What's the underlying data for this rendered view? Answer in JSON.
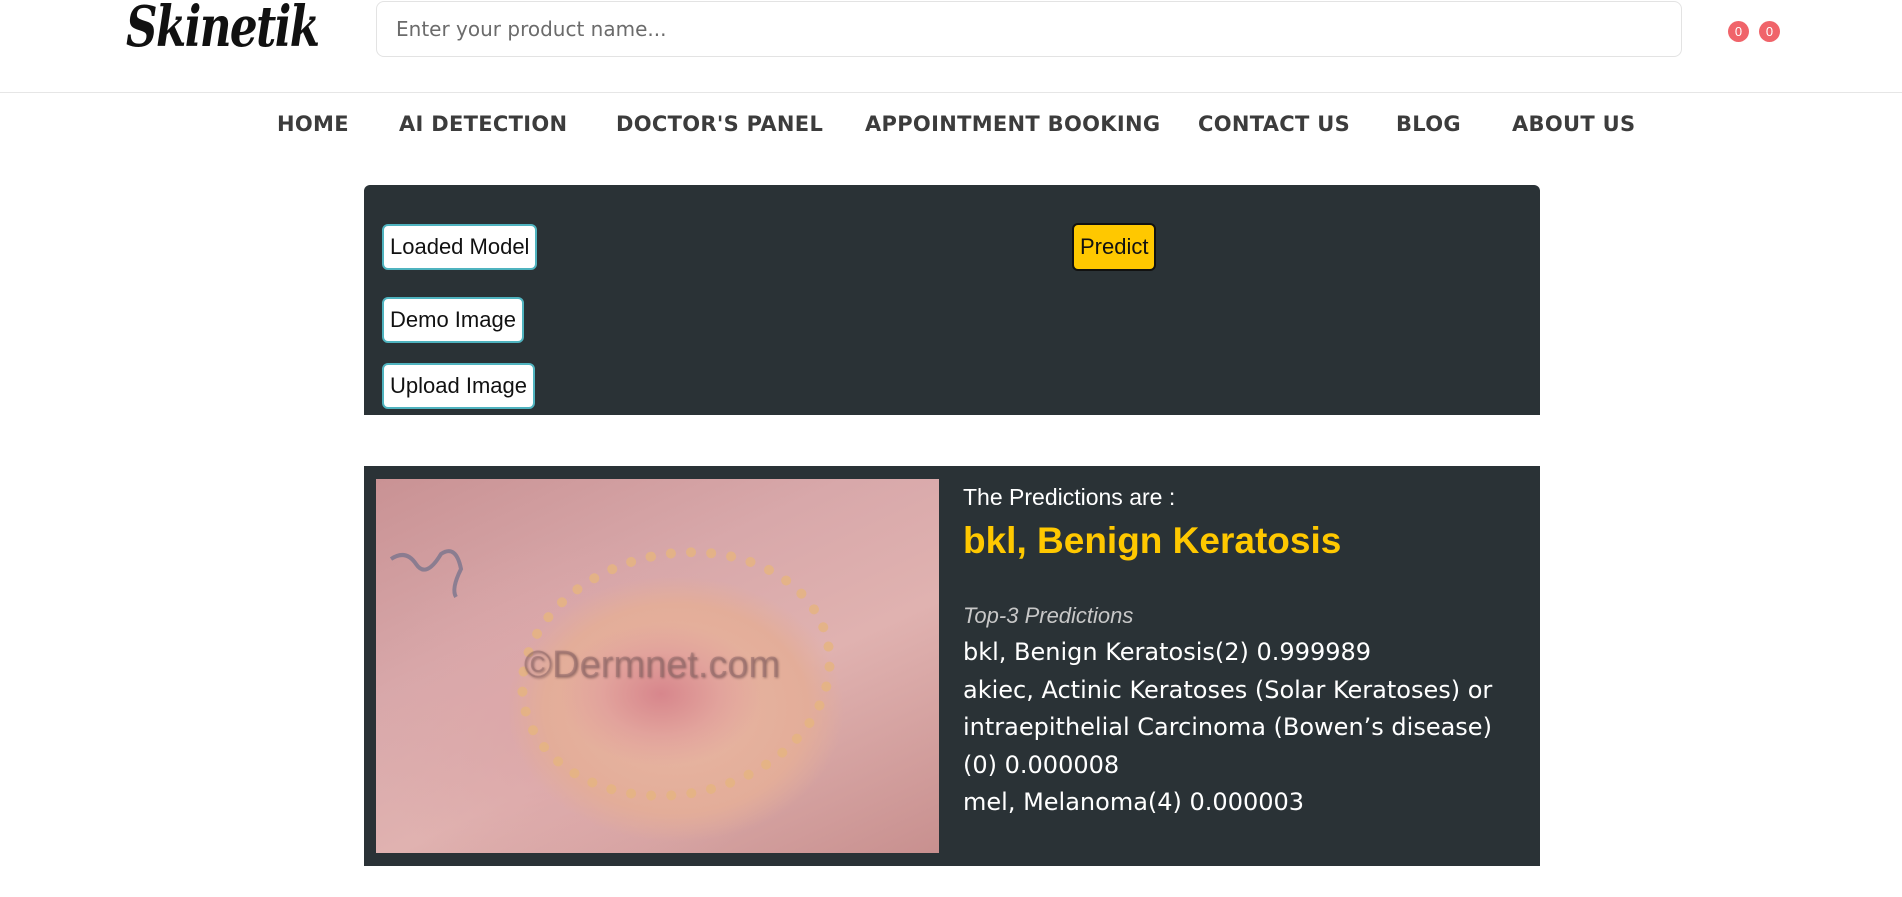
{
  "header": {
    "logo": "Skinetik",
    "search": {
      "placeholder": "Enter your product name...",
      "value": ""
    },
    "badges": [
      "0",
      "0"
    ]
  },
  "nav": {
    "items": [
      {
        "label": "HOME"
      },
      {
        "label": "AI DETECTION"
      },
      {
        "label": "DOCTOR'S PANEL"
      },
      {
        "label": "APPOINTMENT BOOKING"
      },
      {
        "label": "CONTACT US"
      },
      {
        "label": "BLOG"
      },
      {
        "label": "ABOUT US"
      }
    ]
  },
  "controls": {
    "loaded_model": "Loaded Model",
    "demo_image": "Demo Image",
    "upload_image": "Upload Image",
    "predict": "Predict"
  },
  "result": {
    "image": {
      "watermark": "©Dermnet.com"
    },
    "heading": "The Predictions are :",
    "top_prediction": "bkl, Benign Keratosis",
    "subheading": "Top-3 Predictions",
    "predictions": [
      "bkl, Benign Keratosis(2) 0.999989",
      "akiec, Actinic Keratoses (Solar Keratoses) or",
      "intraepithelial Carcinoma (Bowen’s disease)",
      "(0) 0.000008",
      "mel, Melanoma(4) 0.000003"
    ]
  },
  "colors": {
    "panel_bg": "#2a3236",
    "accent": "#ffc800",
    "badge": "#f0646a",
    "button_border": "#4fb3bf"
  }
}
